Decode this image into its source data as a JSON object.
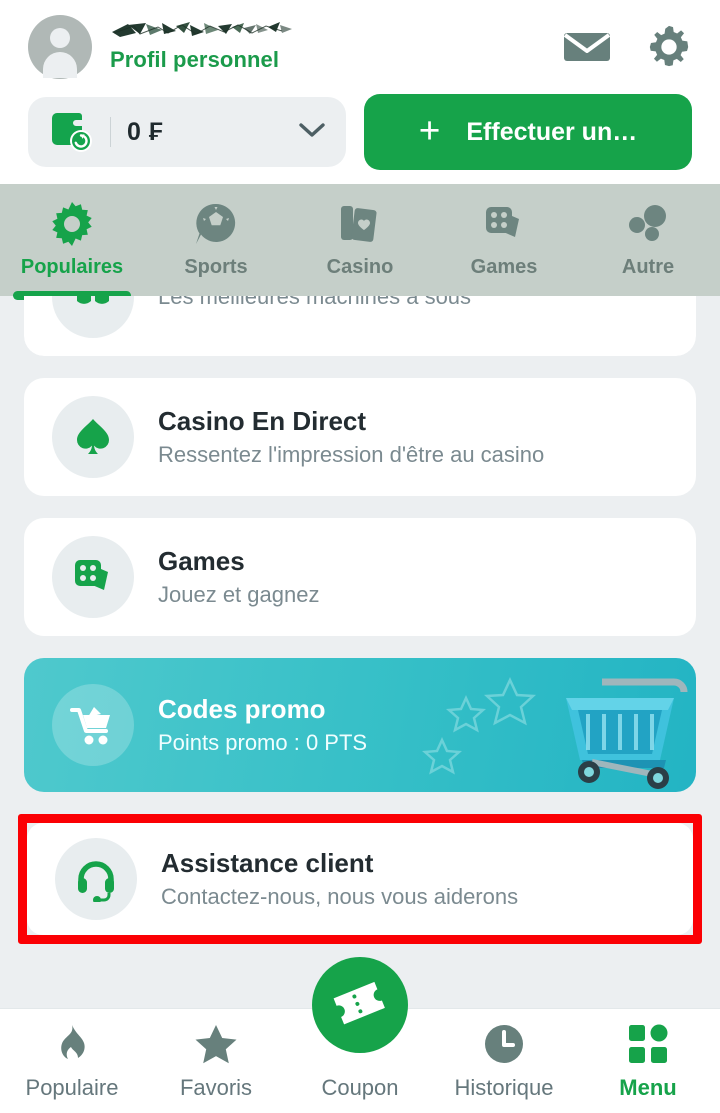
{
  "header": {
    "profile_label": "Profil personnel",
    "username_redacted": true,
    "mail_icon": "mail-icon",
    "settings_icon": "gear-icon",
    "balance": {
      "amount": "0 ₣",
      "wallet_icon": "wallet-refresh-icon",
      "chevron_icon": "chevron-down-icon"
    },
    "deposit_button": {
      "label": "Effectuer un…",
      "plus_icon": "plus-icon"
    }
  },
  "category_tabs": {
    "active_index": 0,
    "items": [
      {
        "label": "Populaires",
        "icon": "starburst-icon"
      },
      {
        "label": "Sports",
        "icon": "soccer-ball-icon"
      },
      {
        "label": "Casino",
        "icon": "playing-cards-icon"
      },
      {
        "label": "Games",
        "icon": "dice-cards-icon"
      },
      {
        "label": "Autre",
        "icon": "three-dots-icon"
      }
    ]
  },
  "menu_list": [
    {
      "title": "",
      "subtitle": "Les meilleures machines à sous",
      "icon": "slot-machine-icon",
      "clipped": true
    },
    {
      "title": "Casino En Direct",
      "subtitle": "Ressentez l'impression d'être au casino",
      "icon": "spade-icon"
    },
    {
      "title": "Games",
      "subtitle": "Jouez et gagnez",
      "icon": "dice-cards-icon"
    }
  ],
  "promo_banner": {
    "title": "Codes promo",
    "subtitle": "Points promo : 0 PTS",
    "icon": "shopping-cart-icon",
    "art": "shopping-cart-illustration"
  },
  "support_card": {
    "title": "Assistance client",
    "subtitle": "Contactez-nous, nous vous aiderons",
    "icon": "headset-icon",
    "highlighted": true,
    "highlight_color": "#fb0004"
  },
  "bottom_nav": {
    "active_index": 4,
    "items": [
      {
        "label": "Populaire",
        "icon": "flame-icon"
      },
      {
        "label": "Favoris",
        "icon": "star-icon"
      },
      {
        "label": "Coupon",
        "icon": "ticket-icon"
      },
      {
        "label": "Historique",
        "icon": "clock-icon"
      },
      {
        "label": "Menu",
        "icon": "grid-menu-icon"
      }
    ]
  },
  "colors": {
    "brand_green": "#16a34a",
    "page_bg": "#eceff1",
    "tabbar_bg": "#c5cfc9",
    "muted_text": "#7b8a90",
    "promo_teal": "#35bfc7",
    "highlight_red": "#fb0004"
  }
}
